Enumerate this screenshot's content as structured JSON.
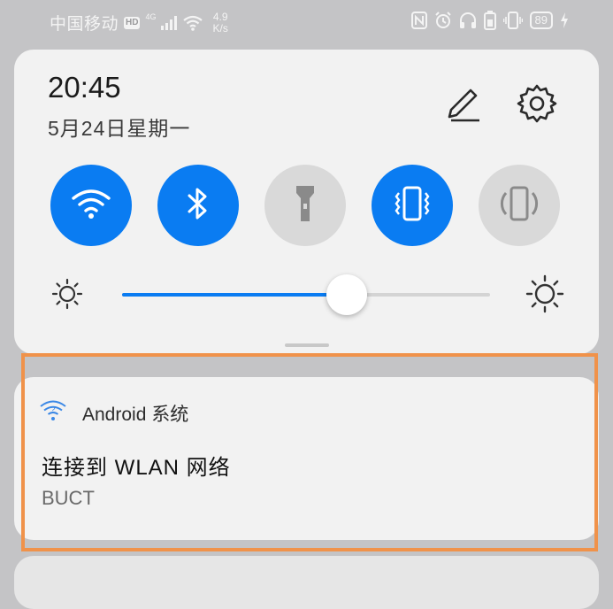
{
  "status_bar": {
    "carrier": "中国移动",
    "hd_label": "HD",
    "network_type": "4G",
    "speed_value": "4.9",
    "speed_unit": "K/s",
    "battery": "89"
  },
  "quick_settings": {
    "time": "20:45",
    "date": "5月24日星期一",
    "tiles": [
      {
        "name": "wlan",
        "icon": "wifi-icon",
        "active": true
      },
      {
        "name": "bluetooth",
        "icon": "bluetooth-icon",
        "active": true
      },
      {
        "name": "flashlight",
        "icon": "flashlight-icon",
        "active": false
      },
      {
        "name": "vibrate",
        "icon": "vibrate-icon",
        "active": true
      },
      {
        "name": "auto-rotate",
        "icon": "rotate-icon",
        "active": false
      }
    ],
    "brightness": {
      "value": 0.61
    }
  },
  "notification": {
    "app_name": "Android 系统",
    "title": "连接到 WLAN 网络",
    "text": "BUCT"
  },
  "colors": {
    "accent": "#0a7cf2",
    "panel": "#f2f2f2",
    "highlight": "#f0924a"
  }
}
